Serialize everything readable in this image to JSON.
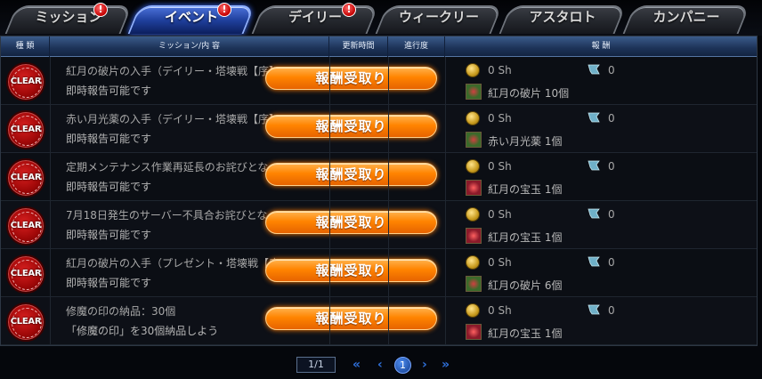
{
  "tabs": [
    {
      "label": "ミッション",
      "alert": "!"
    },
    {
      "label": "イベント",
      "alert": "!"
    },
    {
      "label": "デイリー",
      "alert": "!"
    },
    {
      "label": "ウィークリー"
    },
    {
      "label": "アスタロト"
    },
    {
      "label": "カンパニー"
    }
  ],
  "active_tab": "イベント",
  "columns": [
    "種 類",
    "ミッション/内 容",
    "更新時間",
    "進行度",
    "報 酬"
  ],
  "claim_label": "報酬受取り",
  "clear_label": "CLEAR",
  "rows": [
    {
      "title": "紅月の破片の入手（デイリー・塔壊戦【序】...",
      "sub": "即時報告可能です",
      "coin": "0 Sh",
      "gift": "0",
      "item": "紅月の破片 10個",
      "item_color": "green"
    },
    {
      "title": "赤い月光薬の入手（デイリー・塔壊戦【序】...",
      "sub": "即時報告可能です",
      "coin": "0 Sh",
      "gift": "0",
      "item": "赤い月光薬 1個",
      "item_color": "green"
    },
    {
      "title": "定期メンテナンス作業再延長のお詫びとな...",
      "sub": "即時報告可能です",
      "coin": "0 Sh",
      "gift": "0",
      "item": "紅月の宝玉 1個",
      "item_color": "red"
    },
    {
      "title": "7月18日発生のサーバー不具合お詫びとな...",
      "sub": "即時報告可能です",
      "coin": "0 Sh",
      "gift": "0",
      "item": "紅月の宝玉 1個",
      "item_color": "red"
    },
    {
      "title": "紅月の破片の入手（プレゼント・塔壊戦【序...",
      "sub": "即時報告可能です",
      "coin": "0 Sh",
      "gift": "0",
      "item": "紅月の破片 6個",
      "item_color": "green"
    },
    {
      "title": "修魔の印の納品：30個",
      "sub": "「修魔の印」を30個納品しよう",
      "coin": "0 Sh",
      "gift": "0",
      "item": "紅月の宝玉 1個",
      "item_color": "red"
    }
  ],
  "pager": {
    "display": "1/1",
    "current": "1",
    "first": "«",
    "prev": "‹",
    "next": "›",
    "last": "»"
  }
}
